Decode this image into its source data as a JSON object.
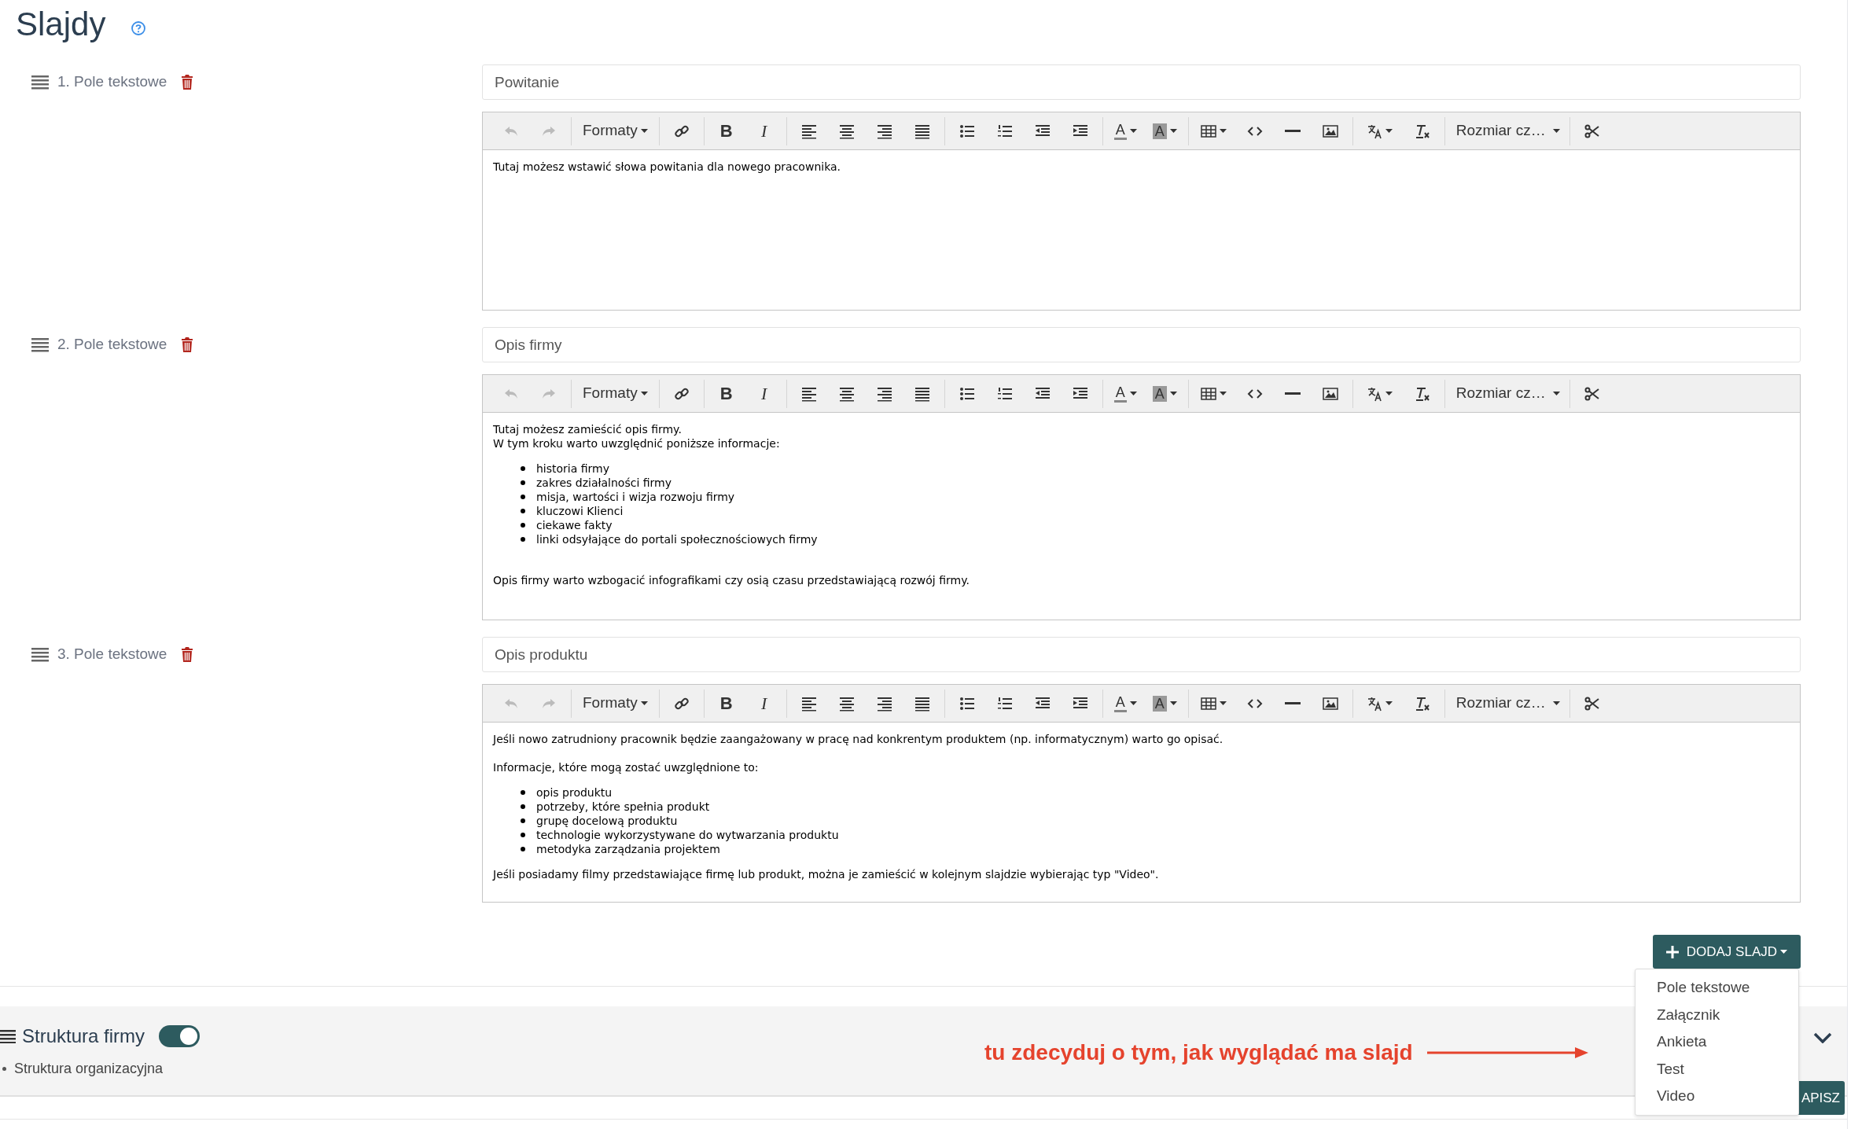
{
  "header": {
    "title": "Slajdy"
  },
  "slides": [
    {
      "label": "1. Pole tekstowe",
      "title_value": "Powitanie",
      "toolbar": {
        "format_menu": "Formaty",
        "bold": "B",
        "italic": "I",
        "text_color": "A",
        "background_color": "A",
        "font_size_menu": "Rozmiar cz…"
      },
      "content": [
        {
          "kind": "line",
          "text": "Tutaj możesz wstawić słowa powitania dla nowego pracownika."
        }
      ]
    },
    {
      "label": "2. Pole tekstowe",
      "title_value": "Opis firmy",
      "toolbar": {
        "format_menu": "Formaty",
        "bold": "B",
        "italic": "I",
        "text_color": "A",
        "background_color": "A",
        "font_size_menu": "Rozmiar cz…"
      },
      "content": [
        {
          "kind": "line",
          "text": "Tutaj możesz zamieścić opis firmy."
        },
        {
          "kind": "line",
          "text": "W tym kroku warto uwzględnić poniższe informacje:"
        },
        {
          "kind": "list",
          "items": [
            "historia firmy",
            "zakres działalności firmy",
            "misja, wartości i wizja rozwoju firmy",
            "kluczowi Klienci",
            "ciekawe fakty",
            "linki odsyłające do portali społecznościowych firmy"
          ]
        },
        {
          "kind": "p_after_blank",
          "text": "Opis firmy warto wzbogacić infografikami czy osią czasu przedstawiającą rozwój firmy."
        }
      ]
    },
    {
      "label": "3. Pole tekstowe",
      "title_value": "Opis produktu",
      "toolbar": {
        "format_menu": "Formaty",
        "bold": "B",
        "italic": "I",
        "text_color": "A",
        "background_color": "A",
        "font_size_menu": "Rozmiar cz…"
      },
      "content": [
        {
          "kind": "p",
          "text": "Jeśli nowo zatrudniony pracownik będzie zaangażowany w pracę nad konkrentym produktem (np. informatycznym) warto go opisać."
        },
        {
          "kind": "line",
          "text": "Informacje, które mogą zostać uwzględnione to:"
        },
        {
          "kind": "list",
          "items": [
            "opis produktu",
            "potrzeby, które spełnia produkt",
            "grupę docelową produktu",
            "technologie wykorzystywane do wytwarzania produktu",
            "metodyka zarządzania projektem"
          ]
        },
        {
          "kind": "line",
          "text": "Jeśli posiadamy filmy przedstawiające firmę lub produkt, można je zamieścić w kolejnym slajdzie wybierając typ \"Video\"."
        }
      ]
    }
  ],
  "add_slide_button": {
    "label": "DODAJ SLAJD"
  },
  "add_slide_menu": [
    "Pole tekstowe",
    "Załącznik",
    "Ankieta",
    "Test",
    "Video"
  ],
  "section": {
    "title": "Struktura firmy",
    "on": true,
    "items": [
      "Struktura organizacyjna"
    ]
  },
  "annotation": "tu zdecyduj o tym, jak wyglądać ma slajd",
  "save_button": {
    "label": "APISZ"
  }
}
